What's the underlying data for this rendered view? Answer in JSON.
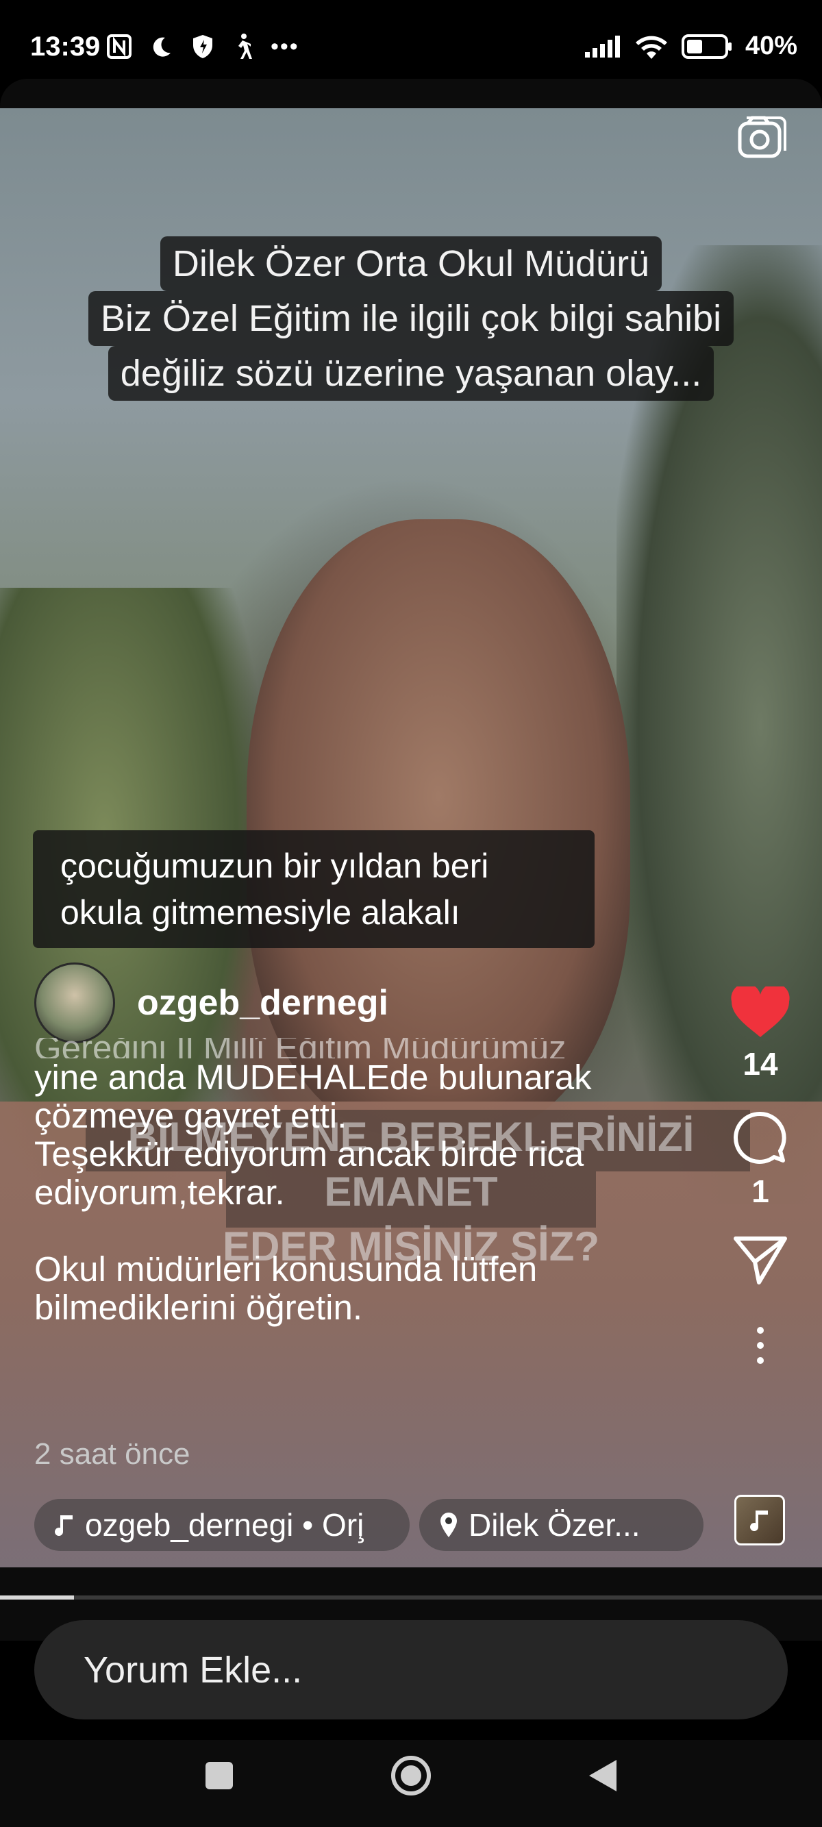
{
  "status_bar": {
    "time": "13:39",
    "more": "•••",
    "battery": "40%"
  },
  "video": {
    "top_caption": [
      "Dilek Özer Orta Okul Müdürü",
      "Biz Özel Eğitim ile ilgili çok bilgi sahibi",
      "değiliz sözü üzerine yaşanan olay..."
    ],
    "subtitle_lines": [
      "çocuğumuzun bir yıldan beri",
      "okula gitmemesiyle alakalı"
    ],
    "background_caption_lines": [
      "BİLMEYENE BEBEKLERİNİZİ EMANET",
      "EDER MİSİNİZ SİZ?"
    ]
  },
  "post": {
    "username": "ozgeb_dernegi",
    "description_cut": "Gėreğini İl Millî Eğitim Müdürümüz",
    "description_lines": [
      "yine anda MUDEHALEde bulunarak",
      "çözmeye gayret etti.",
      "Teşekkür ediyorum ancak birde rica",
      "ediyorum,tekrar.",
      "",
      "Okul müdürleri konusunda lütfen",
      "bilmediklerini öğretin."
    ],
    "time_ago": "2 saat önce",
    "audio_label": "ozgeb_dernegi • Ori̧",
    "location_label": "Dilek Özer..."
  },
  "actions": {
    "like_count": "14",
    "comment_count": "1",
    "like_color": "#f0323c"
  },
  "playback": {
    "progress": 0.09
  },
  "comment_input": {
    "placeholder": "Yorum Ekle..."
  }
}
